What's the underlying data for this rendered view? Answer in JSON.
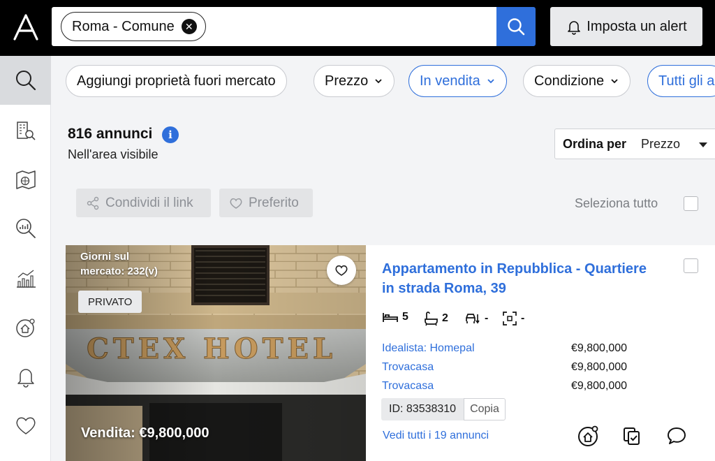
{
  "search": {
    "chip_label": "Roma - Comune",
    "alert_label": "Imposta un alert"
  },
  "filters": [
    {
      "label": "Aggiungi proprietà fuori mercato"
    },
    {
      "label": "Prezzo"
    },
    {
      "label": "In vendita"
    },
    {
      "label": "Condizione"
    },
    {
      "label": "Tutti gli a"
    }
  ],
  "results": {
    "count_label": "816 annunci",
    "area_label": "Nell'area visibile"
  },
  "sort": {
    "label": "Ordina per",
    "value": "Prezzo"
  },
  "actions": {
    "share_label": "Condividi il link",
    "favorite_label": "Preferito",
    "select_all_label": "Seleziona tutto"
  },
  "listing": {
    "days_line1": "Giorni sul",
    "days_line2": "mercato: 232(v)",
    "badge": "PRIVATO",
    "price_overlay": "Vendita: €9,800,000",
    "title_line1": "Appartamento in Repubblica - Quartiere",
    "title_line2": "in strada Roma, 39",
    "beds": "5",
    "baths": "2",
    "feature3": "-",
    "feature4": "-",
    "sources": [
      {
        "name": "Idealista: Homepal",
        "price": "€9,800,000"
      },
      {
        "name": "Trovacasa",
        "price": "€9,800,000"
      },
      {
        "name": "Trovacasa",
        "price": "€9,800,000"
      }
    ],
    "id_label": "ID: 83538310",
    "copy_label": "Copia",
    "see_all_label": "Vedi tutti i 19 annunci"
  },
  "colors": {
    "accent": "#2f6fdb",
    "topbar": "#000000"
  }
}
